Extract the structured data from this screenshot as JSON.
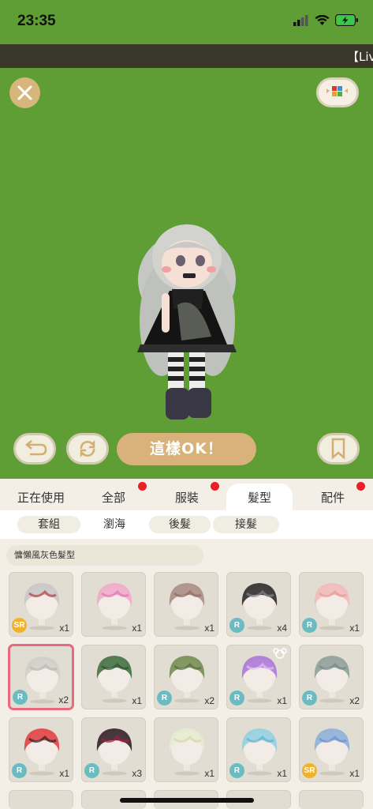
{
  "status": {
    "time": "23:35"
  },
  "ticker": {
    "text": "【Liv"
  },
  "stage": {
    "ok_label": "這樣OK！"
  },
  "tabs": [
    {
      "label": "正在使用",
      "dot": false
    },
    {
      "label": "全部",
      "dot": true
    },
    {
      "label": "服裝",
      "dot": true
    },
    {
      "label": "髮型",
      "dot": false,
      "active": true
    },
    {
      "label": "配件",
      "dot": true
    }
  ],
  "subtabs": [
    {
      "label": "套組"
    },
    {
      "label": "瀏海",
      "active": true
    },
    {
      "label": "後髮"
    },
    {
      "label": "接髮"
    }
  ],
  "set_name": "慵懶風灰色髮型",
  "items": [
    {
      "rarity": "SR",
      "count": "x1",
      "hair": "#c9c6c6",
      "accent": "#b03c3c"
    },
    {
      "rarity": "",
      "count": "x1",
      "hair": "#f0a8c8",
      "accent": "#e070b0"
    },
    {
      "rarity": "",
      "count": "x1",
      "hair": "#a88a80",
      "accent": "#8b6a60"
    },
    {
      "rarity": "R",
      "count": "x4",
      "hair": "#222222",
      "accent": "#888888"
    },
    {
      "rarity": "R",
      "count": "x1",
      "hair": "#f2b8b8",
      "accent": "#e39a9a"
    },
    {
      "rarity": "R",
      "count": "x2",
      "hair": "#cfcfc8",
      "accent": "#b8b8b0",
      "selected": true
    },
    {
      "rarity": "",
      "count": "x1",
      "hair": "#3a6b3a",
      "accent": "#2c532c"
    },
    {
      "rarity": "R",
      "count": "x2",
      "hair": "#6e8a4e",
      "accent": "#55703a"
    },
    {
      "rarity": "R",
      "count": "x1",
      "hair": "#a873d8",
      "accent": "#e3c6f0",
      "bear": true
    },
    {
      "rarity": "R",
      "count": "x2",
      "hair": "#8a9e96",
      "accent": "#748a82"
    },
    {
      "rarity": "R",
      "count": "x1",
      "hair": "#e03a3a",
      "accent": "#222222"
    },
    {
      "rarity": "R",
      "count": "x3",
      "hair": "#2a1620",
      "accent": "#b01a40"
    },
    {
      "rarity": "",
      "count": "x1",
      "hair": "#e6edcf",
      "accent": "#cfd8b0"
    },
    {
      "rarity": "R",
      "count": "x1",
      "hair": "#8fd0e0",
      "accent": "#5fb0d0"
    },
    {
      "rarity": "SR",
      "count": "x1",
      "hair": "#8aaed8",
      "accent": "#6a8ed0"
    }
  ]
}
